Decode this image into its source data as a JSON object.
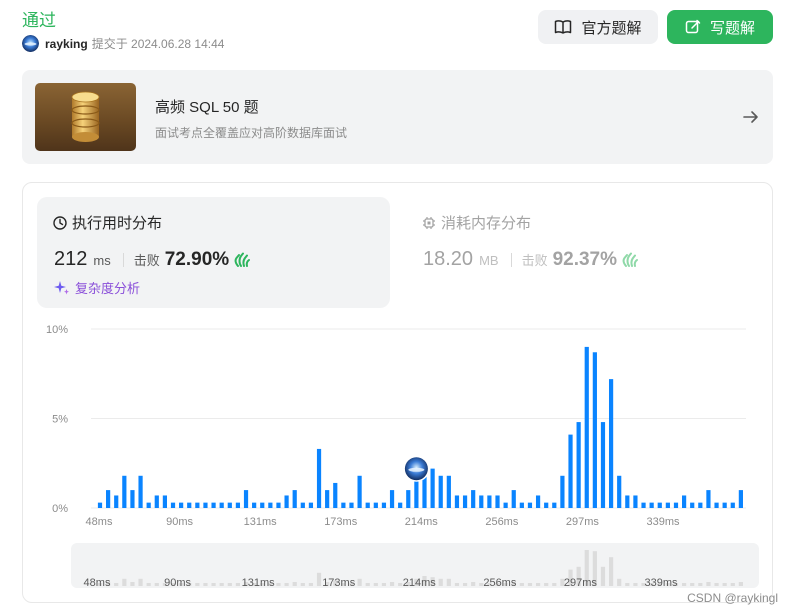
{
  "header": {
    "status": "通过",
    "username": "rayking",
    "submitted": "提交于 2024.06.28 14:44",
    "official_solution_label": "官方题解",
    "write_solution_label": "写题解"
  },
  "study_plan": {
    "title": "高频 SQL 50 题",
    "subtitle": "面试考点全覆盖应对高阶数据库面试"
  },
  "runtime": {
    "heading": "执行用时分布",
    "value": "212",
    "unit": "ms",
    "beats_label": "击败",
    "beats_value": "72.90%",
    "complexity_label": "复杂度分析"
  },
  "memory": {
    "heading": "消耗内存分布",
    "value": "18.20",
    "unit": "MB",
    "beats_label": "击败",
    "beats_value": "92.37%"
  },
  "chart_data": {
    "type": "bar",
    "ylim": [
      0,
      10
    ],
    "y_ticks": [
      "0%",
      "5%",
      "10%"
    ],
    "x_tick_labels": [
      "48ms",
      "90ms",
      "131ms",
      "173ms",
      "214ms",
      "256ms",
      "297ms",
      "339ms"
    ],
    "values": [
      0.3,
      1.0,
      0.7,
      1.8,
      1.0,
      1.8,
      0.3,
      0.7,
      0.7,
      0.3,
      0.3,
      0.3,
      0.3,
      0.3,
      0.3,
      0.3,
      0.3,
      0.3,
      1.0,
      0.3,
      0.3,
      0.3,
      0.3,
      0.7,
      1.0,
      0.3,
      0.3,
      3.3,
      1.0,
      1.4,
      0.3,
      0.3,
      1.8,
      0.3,
      0.3,
      0.3,
      1.0,
      0.3,
      1.0,
      1.8,
      2.5,
      2.2,
      1.8,
      1.8,
      0.7,
      0.7,
      1.0,
      0.7,
      0.7,
      0.7,
      0.3,
      1.0,
      0.3,
      0.3,
      0.7,
      0.3,
      0.3,
      1.8,
      4.1,
      4.8,
      9.0,
      8.7,
      4.8,
      7.2,
      1.8,
      0.7,
      0.7,
      0.3,
      0.3,
      0.3,
      0.3,
      0.3,
      0.7,
      0.3,
      0.3,
      1.0,
      0.3,
      0.3,
      0.3,
      1.0
    ],
    "highlight_index": 39,
    "bar_color": "#0a84ff",
    "grid": true
  },
  "colors": {
    "accent_green": "#2db55d",
    "bar_blue": "#0a84ff"
  },
  "watermark": "CSDN @raykingl"
}
